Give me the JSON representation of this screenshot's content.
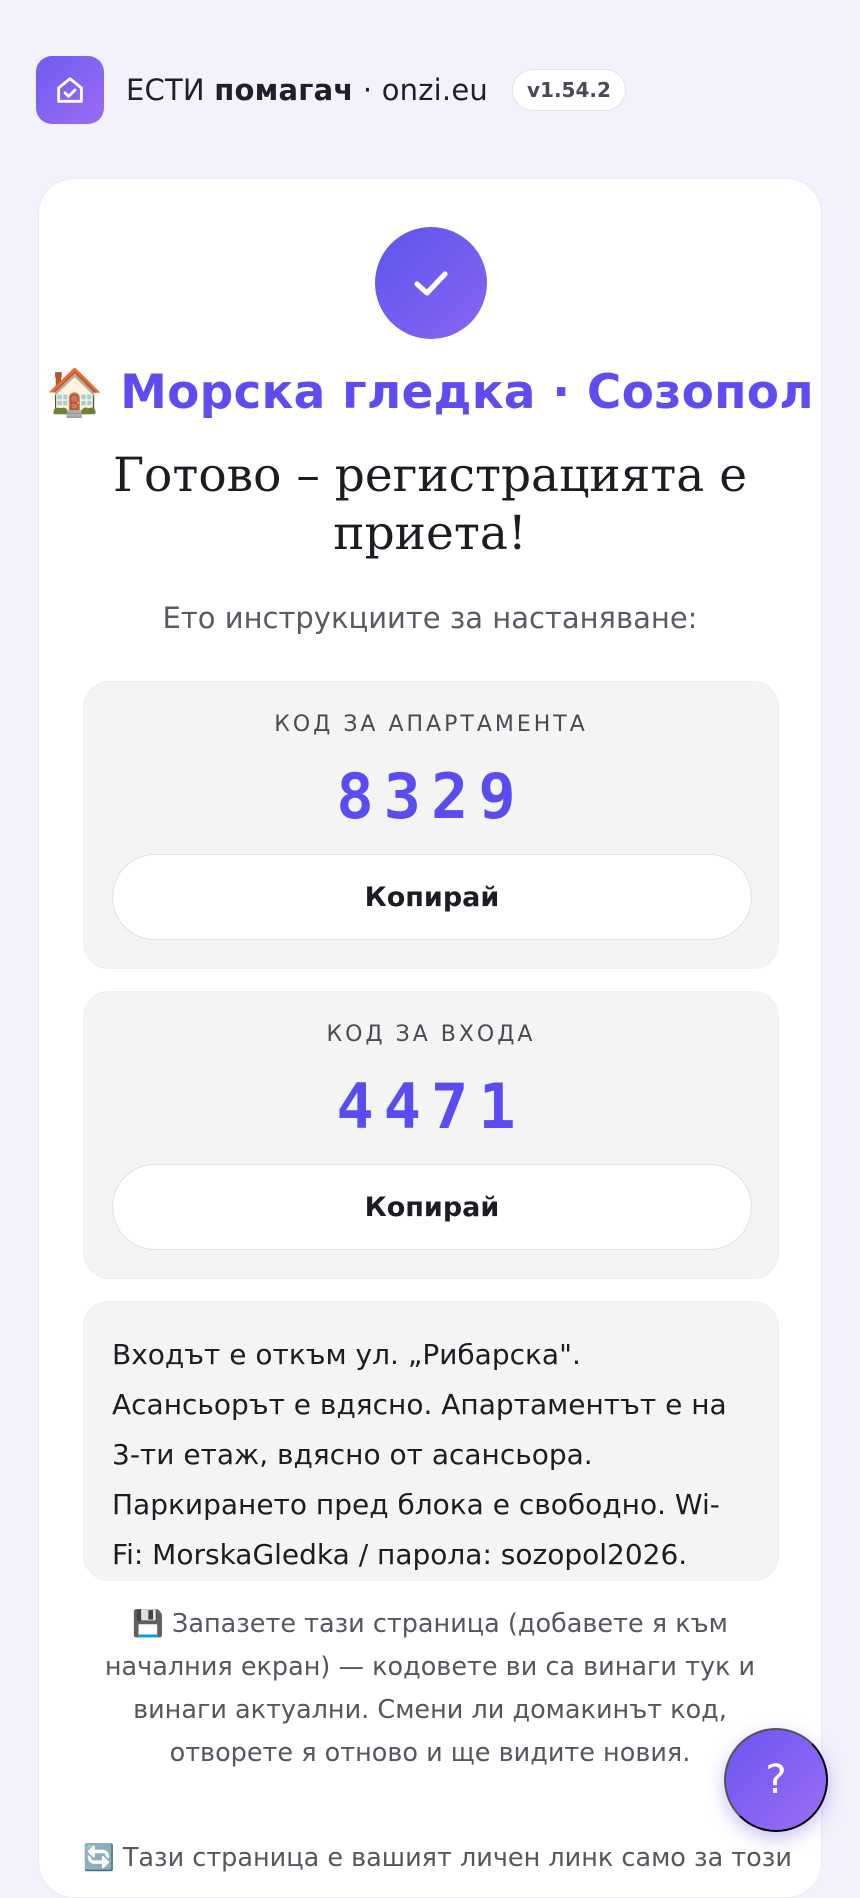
{
  "header": {
    "brand_prefix": "ЕСТИ",
    "brand_bold": "помагач",
    "brand_suffix": "· onzi.eu",
    "version": "v1.54.2",
    "logo_icon": "home-check-icon"
  },
  "card": {
    "check_icon": "checkmark-icon",
    "property_emoji": "🏠",
    "property_name": "Морска гледка · Созопол",
    "heading": "Готово – регистрацията е приета!",
    "subtitle": "Ето инструкциите за настаняване:"
  },
  "codes": [
    {
      "label": "КОД ЗА АПАРТАМЕНТА",
      "value": "8329",
      "button": "Копирай"
    },
    {
      "label": "КОД ЗА ВХОДА",
      "value": "4471",
      "button": "Копирай"
    }
  ],
  "instructions": "Входът е откъм ул. „Рибарска\". Асансьорът е вдясно. Апартаментът е на 3-ти етаж, вдясно от асансьора. Паркирането пред блока е свободно. Wi-Fi: MorskaGledka / парола: sozopol2026.",
  "note_save": "💾 Запазете тази страница (добавете я към началния екран) — кодовете ви са винаги тук и винаги актуални. Смени ли домакинът код, отворете я отново и ще видите новия.",
  "note_link": "🔄 Тази страница е вашият личен линк само за този",
  "help_button": "?",
  "colors": {
    "accent": "#5f4cf0",
    "accent2": "#9b6cf3",
    "background": "#f3f1fc"
  }
}
